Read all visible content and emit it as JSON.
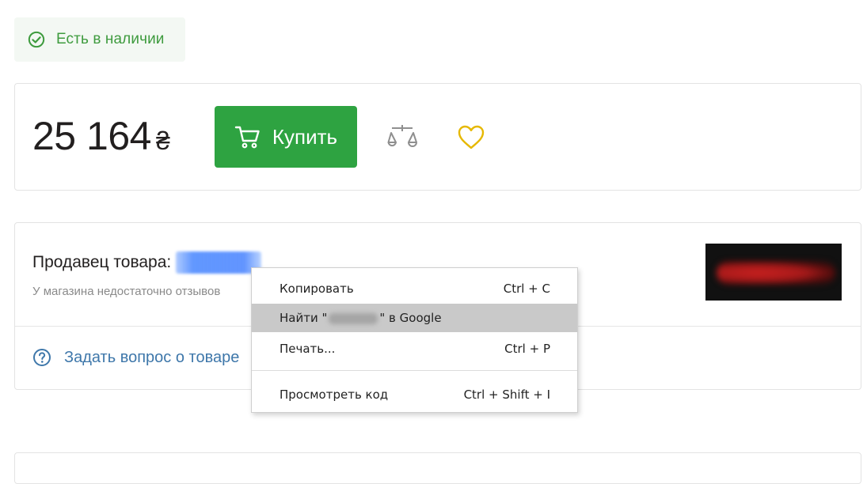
{
  "availability": {
    "text": "Есть в наличии",
    "icon": "check-circle-icon",
    "color": "#3e9b3e"
  },
  "price_block": {
    "price": "25 164",
    "currency": "₴",
    "buy_label": "Купить",
    "buy_icon": "cart-icon",
    "buy_color": "#2ea341",
    "compare_icon": "compare-scales-icon",
    "wishlist_icon": "heart-icon",
    "wishlist_color": "#e6b800"
  },
  "seller": {
    "label": "Продавец товара:",
    "reviews_note": "У магазина недостаточно отзывов",
    "ask_label": "Задать вопрос о товаре",
    "ask_icon": "question-circle-icon"
  },
  "context_menu": {
    "items": [
      {
        "label": "Копировать",
        "shortcut": "Ctrl + C",
        "highlighted": false
      },
      {
        "label_prefix": "Найти \"",
        "label_suffix": "\" в Google",
        "shortcut": "",
        "highlighted": true
      },
      {
        "label": "Печать...",
        "shortcut": "Ctrl + P",
        "highlighted": false
      },
      {
        "label": "Просмотреть код",
        "shortcut": "Ctrl + Shift + I",
        "highlighted": false
      }
    ]
  }
}
